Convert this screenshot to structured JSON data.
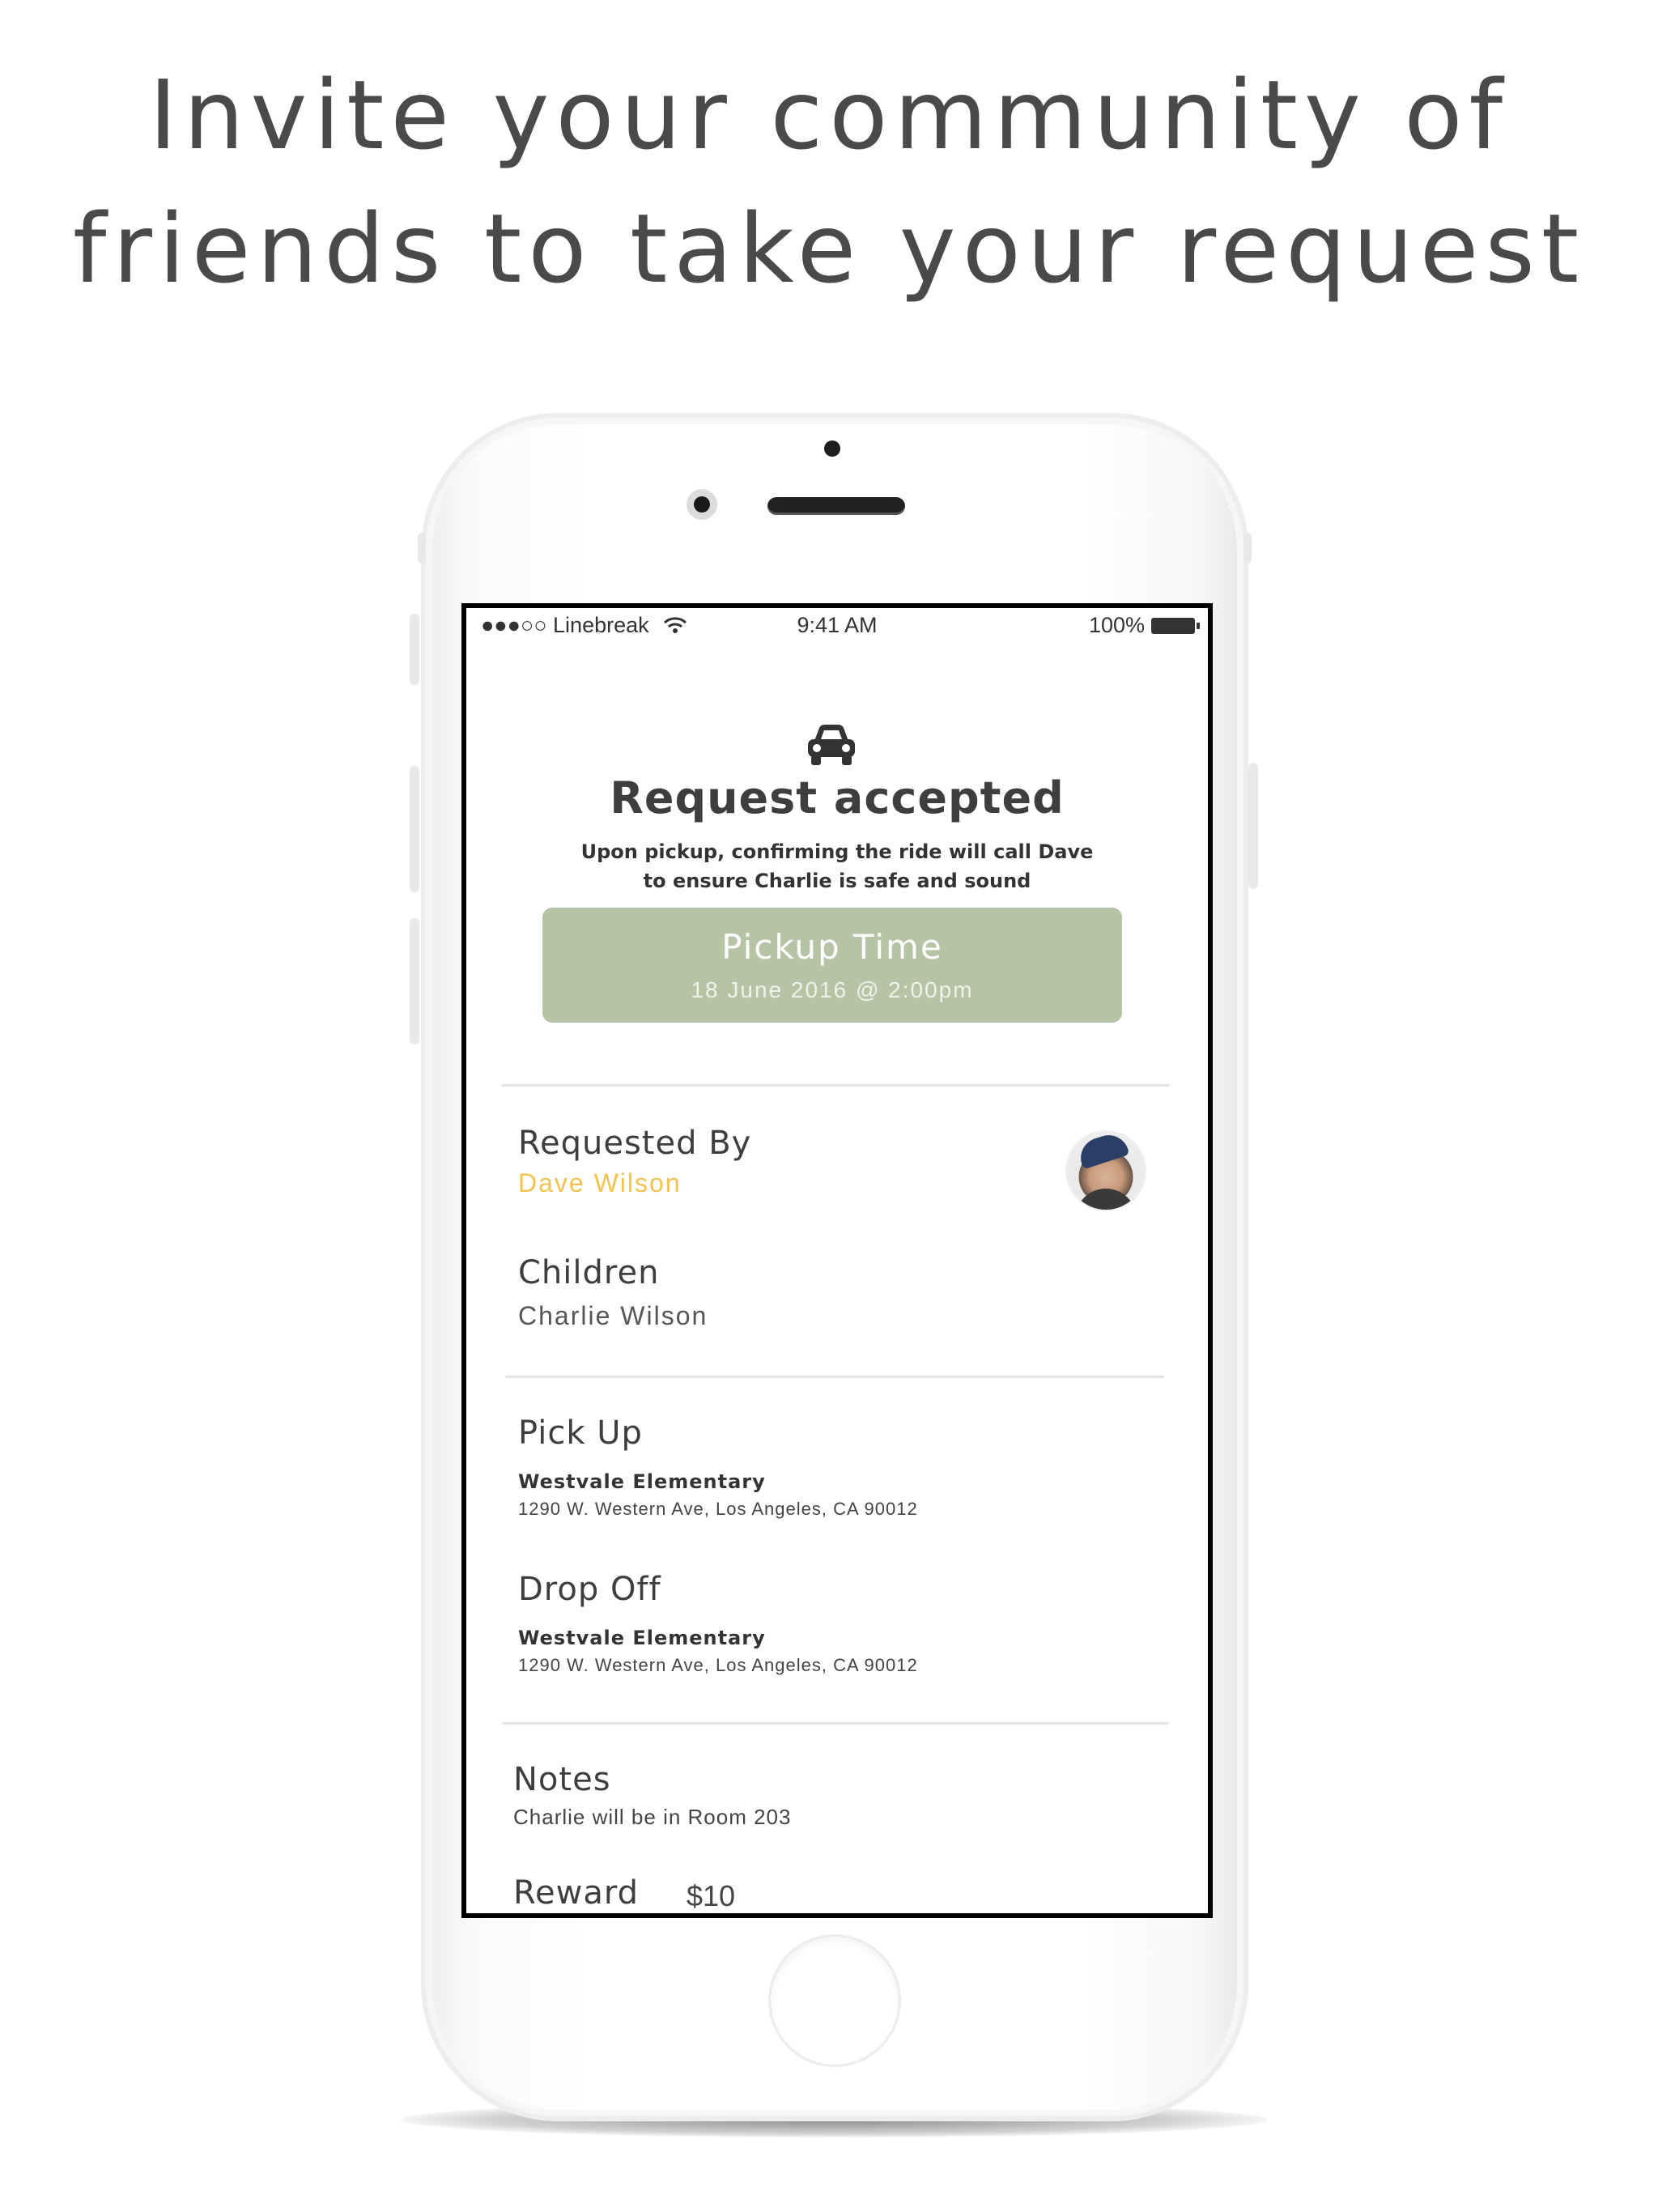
{
  "headline": {
    "line1": "Invite your community of",
    "line2": "friends to take your request"
  },
  "status_bar": {
    "carrier": "●●●○○ Linebreak",
    "time": "9:41 AM",
    "battery": "100%"
  },
  "icons": {
    "car": "car-icon",
    "wifi": "wifi-icon",
    "battery": "battery-icon"
  },
  "request": {
    "title": "Request accepted",
    "subtitle_line1": "Upon pickup, confirming the ride will call Dave",
    "subtitle_line2": "to ensure Charlie is safe and sound"
  },
  "pickup_time": {
    "label": "Pickup Time",
    "value": "18 June 2016 @ 2:00pm"
  },
  "details": {
    "requested_by_label": "Requested By",
    "requested_by_value": "Dave Wilson",
    "children_label": "Children",
    "children_value": "Charlie Wilson",
    "pick_up_label": "Pick Up",
    "pick_up_name": "Westvale Elementary",
    "pick_up_address": "1290 W. Western Ave, Los Angeles, CA 90012",
    "drop_off_label": "Drop Off",
    "drop_off_name": "Westvale Elementary",
    "drop_off_address": "1290 W. Western Ave, Los Angeles, CA 90012",
    "notes_label": "Notes",
    "notes_value": "Charlie will be in Room 203",
    "reward_label": "Reward",
    "reward_value": "$10"
  },
  "colors": {
    "pickup_box": "#b6c4a6",
    "accent_name": "#f2c24e",
    "headline": "#4a4a4a"
  }
}
